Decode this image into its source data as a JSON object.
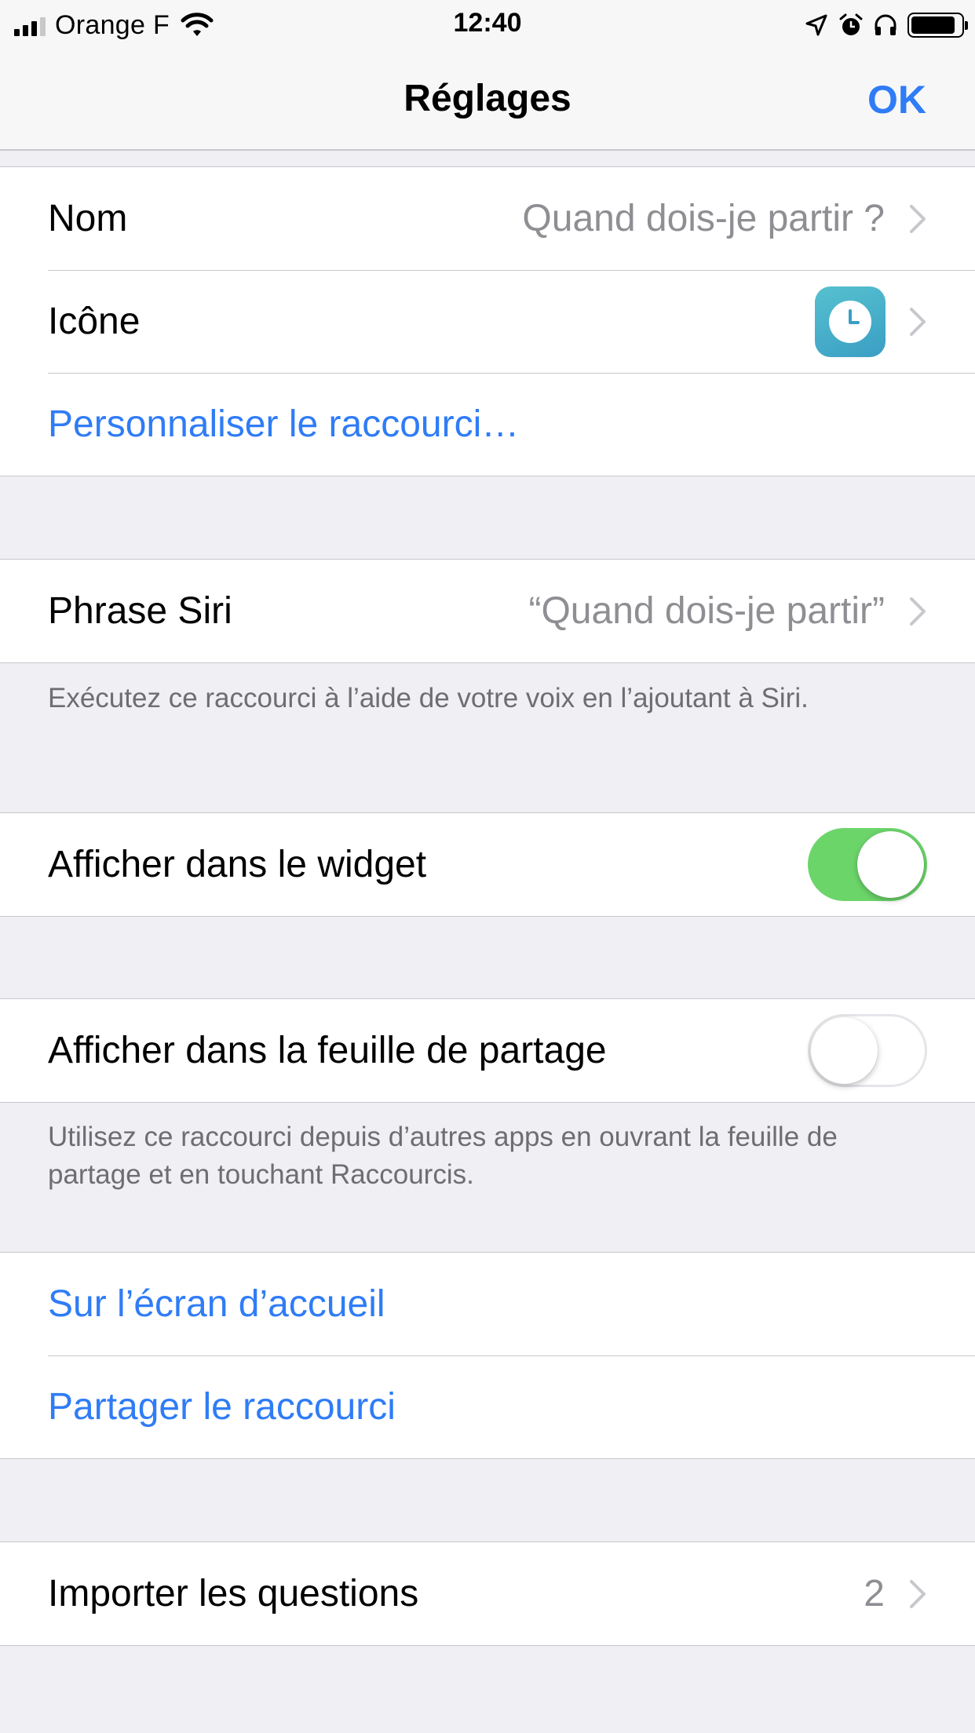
{
  "status_bar": {
    "carrier": "Orange F",
    "time": "12:40"
  },
  "nav": {
    "title": "Réglages",
    "done_label": "OK"
  },
  "group_info": {
    "name_label": "Nom",
    "name_value": "Quand dois-je partir ?",
    "icon_label": "Icône",
    "customize_label": "Personnaliser le raccourci…"
  },
  "group_siri": {
    "phrase_label": "Phrase Siri",
    "phrase_value": "“Quand dois-je partir”",
    "footer": "Exécutez ce raccourci à l’aide de votre voix en l’ajoutant à Siri."
  },
  "group_widget": {
    "label": "Afficher dans le widget",
    "enabled": true
  },
  "group_share_sheet": {
    "label": "Afficher dans la feuille de partage",
    "enabled": false,
    "footer": "Utilisez ce raccourci depuis d’autres apps en ouvrant la feuille de partage et en touchant Raccourcis."
  },
  "group_actions": {
    "home_screen_label": "Sur l’écran d’accueil",
    "share_label": "Partager le raccourci"
  },
  "group_import": {
    "label": "Importer les questions",
    "count": "2"
  },
  "colors": {
    "accent": "#2f7cf6",
    "toggle_on": "#6cd56a",
    "background": "#efeff4",
    "secondary_text": "#8e8e93"
  },
  "icons": [
    "signal-icon",
    "wifi-icon",
    "location-arrow-icon",
    "alarm-icon",
    "headphones-icon",
    "battery-icon",
    "chevron-right-icon",
    "clock-icon"
  ]
}
